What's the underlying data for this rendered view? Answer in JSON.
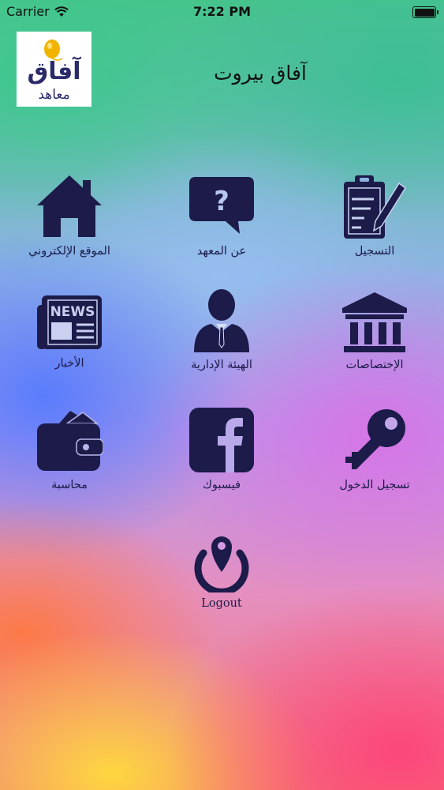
{
  "status_bar": {
    "carrier": "Carrier",
    "time": "7:22 PM",
    "icons": [
      "wifi-icon",
      "battery-icon"
    ]
  },
  "header": {
    "title": "آفاق بيروت",
    "logo": {
      "main_text": "آفاق",
      "sub_text": "معاهد",
      "colors": {
        "text": "#2b2a6a",
        "balloon": "#f0b400"
      }
    }
  },
  "menu": {
    "icon_color": "#1c1b4a",
    "items": [
      {
        "label": "التسجيل",
        "icon": "clipboard-pencil-icon"
      },
      {
        "label": "عن المعهد",
        "icon": "question-bubble-icon"
      },
      {
        "label": "الموقع الإلكتروني",
        "icon": "home-icon"
      },
      {
        "label": "الإختصاصات",
        "icon": "institution-icon"
      },
      {
        "label": "الهيئة الإدارية",
        "icon": "businessman-icon"
      },
      {
        "label": "الأخبار",
        "icon": "newspaper-icon"
      },
      {
        "label": "تسجيل الدخول",
        "icon": "key-icon"
      },
      {
        "label": "فيسبوك",
        "icon": "facebook-icon"
      },
      {
        "label": "محاسبة",
        "icon": "wallet-icon"
      },
      {
        "label": "Logout",
        "icon": "location-power-icon"
      }
    ]
  }
}
